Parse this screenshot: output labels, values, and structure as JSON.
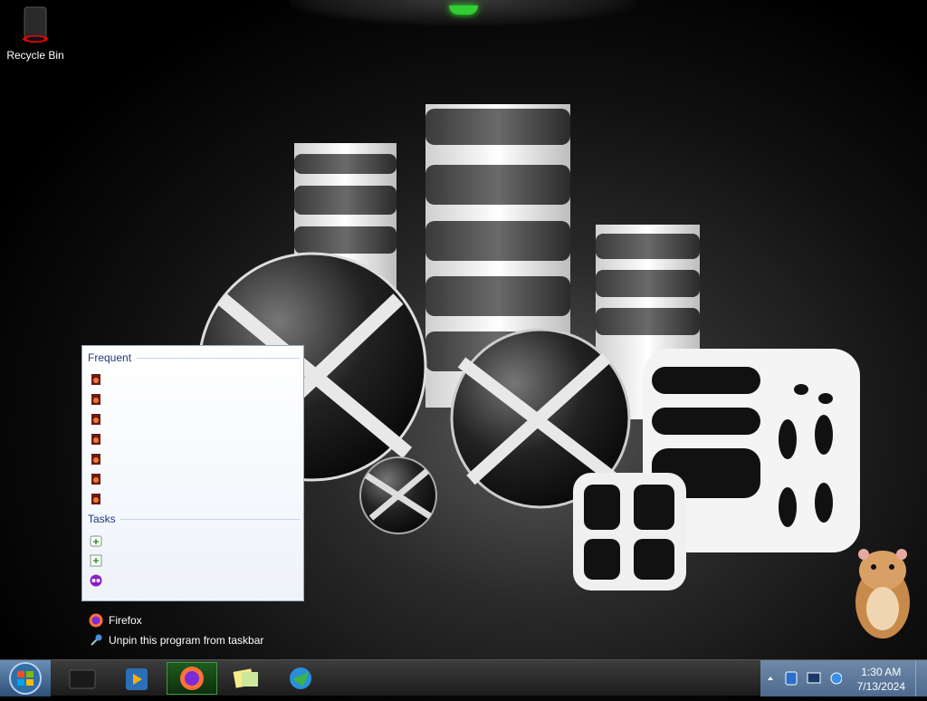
{
  "desktop": {
    "icons": [
      {
        "label": "Recycle Bin",
        "icon": "recycle-bin-icon"
      }
    ]
  },
  "jump_list": {
    "frequent_header": "Frequent",
    "frequent_items": [
      {
        "label": "",
        "icon": "document-icon"
      },
      {
        "label": "",
        "icon": "document-icon"
      },
      {
        "label": "",
        "icon": "document-icon"
      },
      {
        "label": "",
        "icon": "document-icon"
      },
      {
        "label": "",
        "icon": "document-icon"
      },
      {
        "label": "",
        "icon": "document-icon"
      },
      {
        "label": "",
        "icon": "document-icon"
      }
    ],
    "tasks_header": "Tasks",
    "task_items": [
      {
        "label": "",
        "icon": "new-tab-icon"
      },
      {
        "label": "",
        "icon": "new-window-icon"
      },
      {
        "label": "",
        "icon": "private-window-icon"
      }
    ],
    "app_label": "Firefox",
    "unpin_label": "Unpin this program from taskbar"
  },
  "taskbar": {
    "buttons": [
      {
        "icon": "start-orb-icon"
      },
      {
        "icon": "media-player-icon"
      },
      {
        "icon": "explorer-icon"
      },
      {
        "icon": "firefox-icon",
        "active": true
      },
      {
        "icon": "sticky-notes-icon"
      },
      {
        "icon": "download-manager-icon"
      }
    ],
    "tray": {
      "time": "1:30 AM",
      "date": "7/13/2024",
      "icons": [
        "show-hidden-icons-chevron",
        "bluetooth-icon",
        "network-icon",
        "ie-icon"
      ]
    }
  },
  "colors": {
    "accent": "#33cc33",
    "jump_header": "#1e3a7a",
    "tray": "#5a7799"
  }
}
